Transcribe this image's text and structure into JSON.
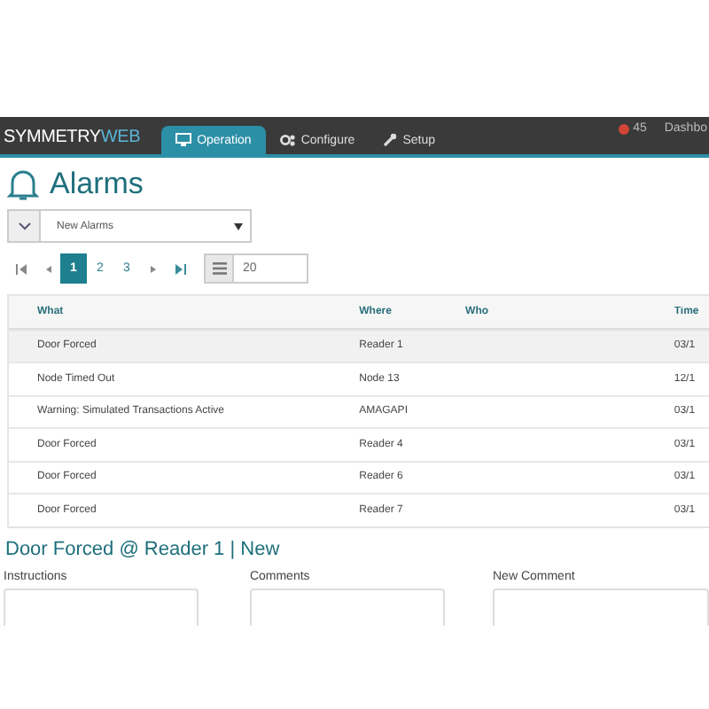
{
  "navbar": {
    "brand": "SYMMETRY",
    "brand_suffix": "WEB",
    "tabs": [
      {
        "label": "Operation",
        "selected": true,
        "kind": "monitor"
      },
      {
        "label": "Configure",
        "selected": false,
        "kind": "gears"
      },
      {
        "label": "Setup",
        "selected": false,
        "kind": "wrench"
      }
    ],
    "alert_count": "45",
    "dashboard": "Dashbo"
  },
  "title": "Alarms",
  "filter": {
    "value": "New Alarms"
  },
  "pagination": {
    "pages": [
      {
        "label": "1",
        "selected": true
      },
      {
        "label": "2",
        "selected": false
      },
      {
        "label": "3",
        "selected": false
      }
    ],
    "page_size": "20"
  },
  "table": {
    "columns": [
      "What",
      "Where",
      "Who",
      "Time"
    ],
    "rows": [
      {
        "cells": [
          "Door Forced",
          "Reader 1",
          "",
          "03/1"
        ],
        "selected": true
      },
      {
        "cells": [
          "Node Timed Out",
          "Node 13",
          "",
          "12/1"
        ],
        "selected": false
      },
      {
        "cells": [
          "Warning: Simulated Transactions Active",
          "AMAGAPI",
          "",
          "03/1"
        ],
        "selected": false
      },
      {
        "cells": [
          "Door Forced",
          "Reader 4",
          "",
          "03/1"
        ],
        "selected": false
      },
      {
        "cells": [
          "Door Forced",
          "Reader 6",
          "",
          "03/1"
        ],
        "selected": false
      },
      {
        "cells": [
          "Door Forced",
          "Reader 7",
          "",
          "03/1"
        ],
        "selected": false
      }
    ]
  },
  "detail": {
    "title": "Door Forced @ Reader 1 | New",
    "sections": [
      "Instructions",
      "Comments",
      "New Comment"
    ]
  }
}
